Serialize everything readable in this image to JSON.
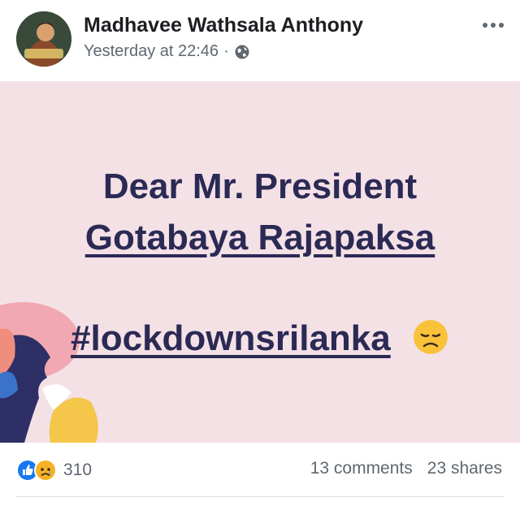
{
  "post": {
    "author": "Madhavee Wathsala Anthony",
    "timestamp": "Yesterday at 22:46",
    "separator": "·",
    "privacy_icon": "globe-icon",
    "image_text": {
      "line1": "Dear Mr. President",
      "line2": "Gotabaya Rajapaksa",
      "line3": "#lockdownsrilanka"
    },
    "reaction_icons": [
      "like-icon",
      "sad-icon"
    ],
    "reaction_count": "310",
    "comments": "13 comments",
    "shares": "23 shares"
  },
  "colors": {
    "post_bg": "#f4e1e6",
    "text_navy": "#2b2a55",
    "like_blue": "#1877f2",
    "meta_gray": "#606770"
  }
}
